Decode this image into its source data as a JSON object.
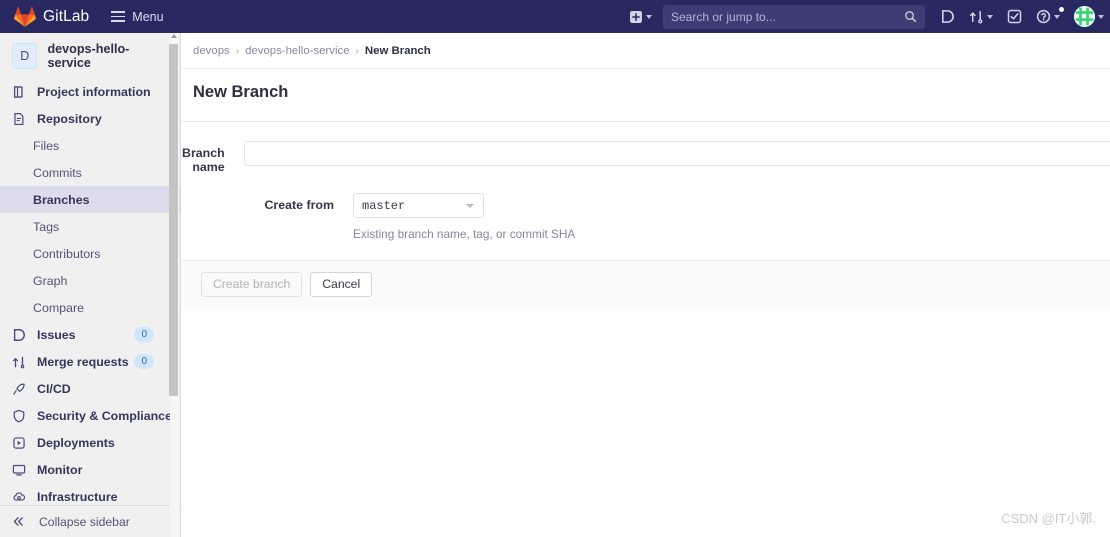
{
  "topbar": {
    "brand": "GitLab",
    "logo_icon": "gitlab-fox-logo",
    "menu_label": "Menu",
    "menu_icon": "hamburger-icon",
    "create_new_icon": "plus-square-icon",
    "search": {
      "placeholder": "Search or jump to...",
      "value": "",
      "icon": "search-icon"
    },
    "issues_icon": "issues-icon",
    "merge_requests_icon": "merge-request-icon",
    "todos_icon": "todo-checkmark-icon",
    "help_icon": "help-question-icon",
    "avatar_icon": "user-avatar",
    "bg_color": "#292961"
  },
  "sidebar": {
    "project": {
      "initial": "D",
      "name": "devops-hello-service",
      "avatar_name": "project-avatar"
    },
    "items": [
      {
        "label": "Project information",
        "icon": "project-information-icon",
        "type": "top"
      },
      {
        "label": "Repository",
        "icon": "repository-doc-icon",
        "type": "top",
        "active_section": true
      },
      {
        "label": "Files",
        "type": "sub"
      },
      {
        "label": "Commits",
        "type": "sub"
      },
      {
        "label": "Branches",
        "type": "sub",
        "active": true
      },
      {
        "label": "Tags",
        "type": "sub"
      },
      {
        "label": "Contributors",
        "type": "sub"
      },
      {
        "label": "Graph",
        "type": "sub"
      },
      {
        "label": "Compare",
        "type": "sub"
      },
      {
        "label": "Issues",
        "icon": "issues-icon",
        "type": "top",
        "badge": "0"
      },
      {
        "label": "Merge requests",
        "icon": "merge-request-icon",
        "type": "top",
        "badge": "0"
      },
      {
        "label": "CI/CD",
        "icon": "rocket-icon",
        "type": "top"
      },
      {
        "label": "Security & Compliance",
        "icon": "shield-icon",
        "type": "top"
      },
      {
        "label": "Deployments",
        "icon": "deployments-icon",
        "type": "top"
      },
      {
        "label": "Monitor",
        "icon": "monitor-icon",
        "type": "top"
      },
      {
        "label": "Infrastructure",
        "icon": "cloud-infrastructure-icon",
        "type": "top"
      }
    ],
    "collapse": {
      "label": "Collapse sidebar",
      "icon": "double-chevron-left-icon"
    },
    "active_bg": "#dcdcec",
    "badge_color": "#cfe6fb"
  },
  "breadcrumb": {
    "items": [
      "devops",
      "devops-hello-service",
      "New Branch"
    ],
    "separator": "›"
  },
  "page": {
    "title": "New Branch"
  },
  "form": {
    "branch_name": {
      "label": "Branch name",
      "value": "",
      "placeholder": ""
    },
    "create_from": {
      "label": "Create from",
      "value": "master",
      "caret_icon": "chevron-down-icon",
      "help": "Existing branch name, tag, or commit SHA"
    },
    "submit_label": "Create branch",
    "cancel_label": "Cancel"
  },
  "watermark": {
    "text": "CSDN @IT小郭."
  }
}
